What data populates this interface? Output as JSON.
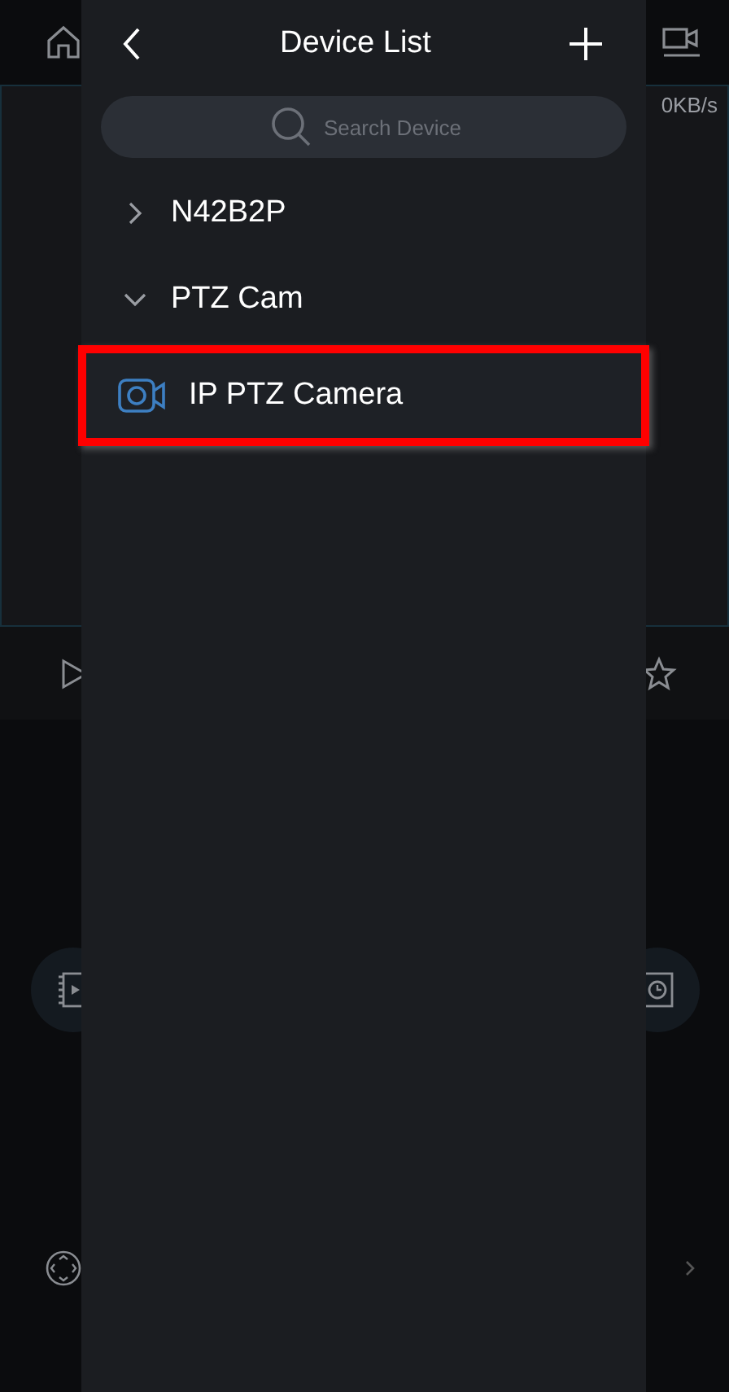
{
  "background": {
    "speed": "0KB/s"
  },
  "panel": {
    "title": "Device List",
    "search": {
      "placeholder": "Search Device"
    },
    "devices": [
      {
        "name": "N42B2P",
        "expanded": false
      },
      {
        "name": "PTZ Cam",
        "expanded": true,
        "children": [
          {
            "name": "IP PTZ Camera",
            "highlighted": true
          }
        ]
      }
    ]
  }
}
